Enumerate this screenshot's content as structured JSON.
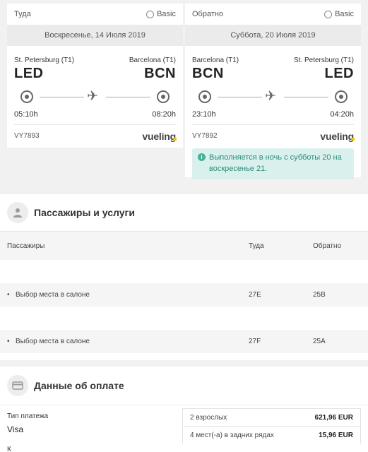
{
  "outbound": {
    "direction": "Туда",
    "fare": "Basic",
    "date": "Воскресенье, 14 Июля 2019",
    "from_city": "St. Petersburg (T1)",
    "to_city": "Barcelona (T1)",
    "from_code": "LED",
    "to_code": "BCN",
    "departure_time": "05:10h",
    "arrival_time": "08:20h",
    "flight_number": "VY7893",
    "airline": "vueling"
  },
  "return": {
    "direction": "Обратно",
    "fare": "Basic",
    "date": "Суббота, 20 Июля 2019",
    "from_city": "Barcelona (T1)",
    "to_city": "St. Petersburg (T1)",
    "from_code": "BCN",
    "to_code": "LED",
    "departure_time": "23:10h",
    "arrival_time": "04:20h",
    "flight_number": "VY7892",
    "airline": "vueling",
    "notice": "Выполняется в ночь с субботы 20 на воскресенье 21."
  },
  "passengers_section": {
    "title": "Пассажиры и услуги",
    "columns": [
      "Пассажиры",
      "Туда",
      "Обратно"
    ],
    "rows": [
      {
        "service": "Выбор места в салоне",
        "outbound": "27E",
        "return": "25B"
      },
      {
        "service": "Выбор места в салоне",
        "outbound": "27F",
        "return": "25A"
      }
    ]
  },
  "payment_section": {
    "title": "Данные об оплате",
    "payment_type_label": "Тип платежа",
    "payment_type_value": "Visa",
    "second_label": "К",
    "summary": [
      {
        "label": "2 взрослых",
        "amount": "621,96 EUR"
      },
      {
        "label": "4 мест(-а) в задних рядах",
        "amount": "15,96 EUR"
      }
    ]
  },
  "colors": {
    "notice_bg": "#d9f0ec",
    "notice_text": "#2e8c7d",
    "page_bg": "#f1f1f1"
  }
}
